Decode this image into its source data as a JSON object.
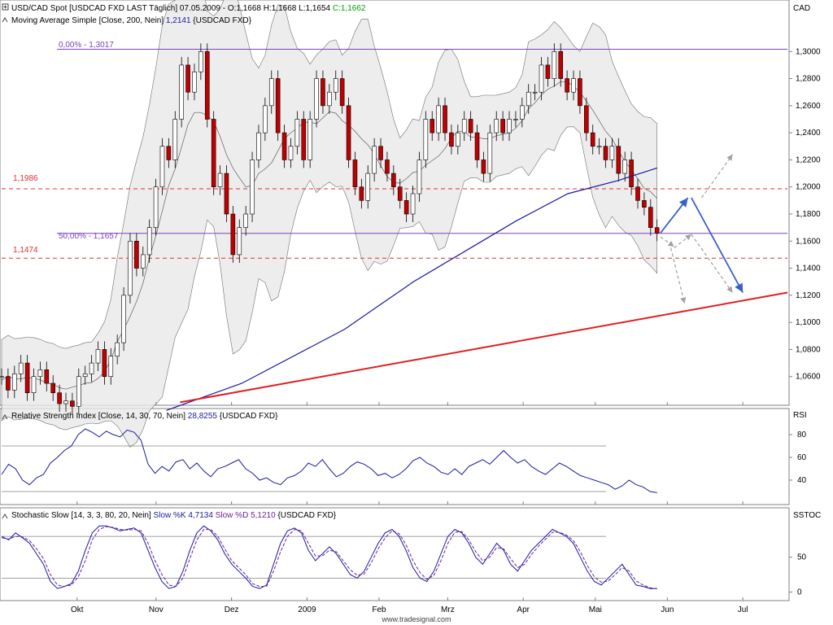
{
  "panels": {
    "price": {
      "symbol_prefix": "USD/CAD Spot [USDCAD FXD LAST Täglich] 07.05.2009 - O:",
      "open": "1,1668",
      "high_label": "H:",
      "high": "1,1668",
      "low_label": "L:",
      "low": "1,1654",
      "close_label": "C:",
      "close": "1,1662",
      "ma_label": "Moving Average Simple [Close, 200, Nein]",
      "ma_value": "1,2141",
      "ma_suffix": "{USDCAD FXD}",
      "axis_unit": "CAD",
      "fib_0_label": "0,00% - 1,3017",
      "fib_50_label": "50,00% - 1,1657",
      "level_1_label": "1,1986",
      "level_2_label": "1,1474"
    },
    "rsi": {
      "title": "Relative Strength Index [Close, 14, 30, 70, Nein]",
      "value": "28,8255",
      "suffix": "{USDCAD FXD}",
      "axis_unit": "RSI"
    },
    "stoch": {
      "title": "Stochastic Slow [14, 3, 3, 80, 20, Nein]",
      "k_label": "Slow %K",
      "k_value": "4,7134",
      "d_label": "Slow %D",
      "d_value": "5,1210",
      "suffix": "{USDCAD FXD}",
      "axis_unit": "SSTOC"
    }
  },
  "watermark": "www.tradesignal.com",
  "colors": {
    "up_candle": "#ffffff",
    "down_candle": "#c00000",
    "ma200": "#1a1aa0",
    "bollinger": "#707070",
    "fib": "#8040c0",
    "support_resistance": "#e03030",
    "trendline": "#e02020",
    "scenario_primary": "#3a5fd0",
    "scenario_alt": "#a0a0a0",
    "rsi_line": "#1a1aa0",
    "stoch_k": "#1a1aa0",
    "stoch_d": "#7020a0"
  },
  "chart_data": [
    {
      "type": "candlestick",
      "panel": "price",
      "x_labels": [
        "Okt",
        "Nov",
        "Dez",
        "2009",
        "Feb",
        "Mrz",
        "Apr",
        "Mai",
        "Jun",
        "Jul"
      ],
      "x_label_trading_day": [
        22,
        45,
        67,
        89,
        110,
        130,
        152,
        173,
        194,
        216
      ],
      "x_range": [
        0,
        229
      ],
      "ylim": [
        1.04,
        1.32
      ],
      "y_ticks": [
        "1,3000",
        "1,2800",
        "1,2600",
        "1,2400",
        "1,2200",
        "1,2000",
        "1,1800",
        "1,1600",
        "1,1400",
        "1,1200",
        "1,1000",
        "1,0800",
        "1,0600"
      ],
      "y_tick_values": [
        1.3,
        1.28,
        1.26,
        1.24,
        1.22,
        1.2,
        1.18,
        1.16,
        1.14,
        1.12,
        1.1,
        1.08,
        1.06
      ],
      "series": [
        {
          "name": "USD/CAD Spot",
          "approx_close": [
            1.06,
            1.05,
            1.062,
            1.07,
            1.048,
            1.06,
            1.065,
            1.055,
            1.048,
            1.04,
            1.042,
            1.038,
            1.06,
            1.062,
            1.07,
            1.08,
            1.06,
            1.075,
            1.085,
            1.12,
            1.16,
            1.14,
            1.15,
            1.17,
            1.2,
            1.23,
            1.22,
            1.25,
            1.29,
            1.27,
            1.285,
            1.3,
            1.25,
            1.2,
            1.21,
            1.18,
            1.15,
            1.17,
            1.18,
            1.22,
            1.24,
            1.26,
            1.28,
            1.24,
            1.22,
            1.23,
            1.25,
            1.22,
            1.25,
            1.28,
            1.26,
            1.27,
            1.28,
            1.26,
            1.22,
            1.2,
            1.19,
            1.21,
            1.23,
            1.22,
            1.21,
            1.2,
            1.19,
            1.18,
            1.195,
            1.22,
            1.25,
            1.24,
            1.26,
            1.24,
            1.23,
            1.24,
            1.25,
            1.24,
            1.22,
            1.21,
            1.24,
            1.25,
            1.24,
            1.25,
            1.25,
            1.26,
            1.27,
            1.27,
            1.29,
            1.28,
            1.3,
            1.28,
            1.27,
            1.28,
            1.26,
            1.24,
            1.23,
            1.23,
            1.22,
            1.23,
            1.21,
            1.22,
            1.2,
            1.19,
            1.185,
            1.17,
            1.166
          ]
        },
        {
          "name": "Moving Average Simple 200",
          "points": [
            [
              48,
              1.035
            ],
            [
              70,
              1.055
            ],
            [
              100,
              1.095
            ],
            [
              120,
              1.13
            ],
            [
              140,
              1.16
            ],
            [
              150,
              1.175
            ],
            [
              165,
              1.195
            ],
            [
              180,
              1.205
            ],
            [
              191,
              1.214
            ]
          ]
        }
      ],
      "levels": [
        {
          "label": "0,00% - 1,3017",
          "value": 1.3017
        },
        {
          "label": "50,00% - 1,1657",
          "value": 1.1657
        },
        {
          "label": "1,1986",
          "value": 1.1986
        },
        {
          "label": "1,1474",
          "value": 1.1474
        }
      ]
    },
    {
      "type": "line",
      "panel": "rsi",
      "ylim": [
        20,
        90
      ],
      "y_ticks": [
        80,
        60,
        40
      ],
      "levels": [
        30,
        70
      ],
      "series": [
        {
          "name": "Relative Strength Index",
          "values": [
            45,
            54,
            50,
            40,
            36,
            42,
            45,
            55,
            60,
            66,
            70,
            80,
            85,
            82,
            78,
            83,
            80,
            78,
            84,
            82,
            75,
            54,
            46,
            52,
            48,
            56,
            58,
            50,
            55,
            48,
            43,
            50,
            52,
            55,
            58,
            50,
            46,
            40,
            42,
            38,
            36,
            42,
            44,
            48,
            55,
            52,
            58,
            50,
            43,
            46,
            52,
            56,
            54,
            50,
            44,
            46,
            42,
            45,
            50,
            57,
            60,
            55,
            52,
            47,
            45,
            50,
            45,
            52,
            55,
            58,
            54,
            60,
            66,
            60,
            55,
            58,
            52,
            48,
            45,
            50,
            55,
            52,
            48,
            44,
            42,
            40,
            38,
            36,
            32,
            35,
            40,
            36,
            34,
            30,
            29
          ]
        }
      ]
    },
    {
      "type": "line",
      "panel": "stochastic",
      "ylim": [
        -10,
        100
      ],
      "y_ticks": [
        50,
        0
      ],
      "levels": [
        20,
        80
      ],
      "series": [
        {
          "name": "Slow %K",
          "values": [
            80,
            75,
            85,
            78,
            70,
            55,
            40,
            15,
            5,
            8,
            12,
            30,
            60,
            85,
            95,
            95,
            92,
            88,
            90,
            92,
            85,
            60,
            35,
            15,
            5,
            8,
            30,
            60,
            85,
            95,
            88,
            75,
            55,
            40,
            30,
            20,
            8,
            5,
            10,
            40,
            70,
            88,
            92,
            85,
            60,
            45,
            55,
            65,
            55,
            40,
            25,
            20,
            30,
            50,
            70,
            85,
            90,
            80,
            60,
            35,
            20,
            15,
            30,
            55,
            80,
            90,
            85,
            70,
            50,
            40,
            55,
            70,
            60,
            40,
            30,
            45,
            60,
            70,
            80,
            90,
            85,
            80,
            70,
            50,
            30,
            15,
            10,
            20,
            30,
            40,
            25,
            10,
            8,
            5,
            5
          ]
        },
        {
          "name": "Slow %D",
          "values": [
            78,
            76,
            80,
            79,
            74,
            62,
            48,
            25,
            10,
            8,
            10,
            22,
            45,
            75,
            90,
            94,
            93,
            90,
            89,
            90,
            88,
            70,
            45,
            25,
            10,
            8,
            20,
            48,
            75,
            90,
            90,
            80,
            62,
            45,
            35,
            25,
            12,
            8,
            8,
            30,
            58,
            80,
            90,
            88,
            70,
            52,
            52,
            60,
            58,
            45,
            32,
            24,
            26,
            42,
            62,
            78,
            88,
            84,
            68,
            45,
            28,
            18,
            24,
            45,
            70,
            86,
            87,
            75,
            58,
            45,
            50,
            64,
            62,
            48,
            35,
            40,
            54,
            66,
            76,
            86,
            86,
            82,
            74,
            58,
            38,
            22,
            14,
            16,
            25,
            35,
            30,
            16,
            10,
            6,
            5
          ]
        }
      ]
    }
  ]
}
